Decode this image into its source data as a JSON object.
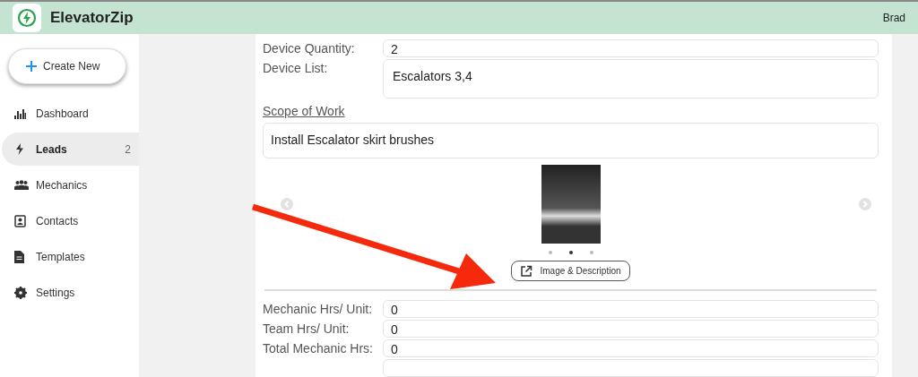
{
  "header": {
    "app_name": "ElevatorZip",
    "user": "Brad"
  },
  "sidebar": {
    "create_button": "Create New",
    "items": [
      {
        "kind": "dashboard",
        "label": "Dashboard",
        "selected": false
      },
      {
        "kind": "leads",
        "label": "Leads",
        "count": "2",
        "selected": true
      },
      {
        "kind": "mechanics",
        "label": "Mechanics",
        "selected": false
      },
      {
        "kind": "contacts",
        "label": "Contacts",
        "selected": false
      },
      {
        "kind": "templates",
        "label": "Templates",
        "selected": false
      },
      {
        "kind": "settings",
        "label": "Settings",
        "selected": false
      }
    ]
  },
  "device_fields": [
    {
      "label": "Device Quantity:",
      "value": "2",
      "kind": "single"
    },
    {
      "label": "Device List:",
      "value": "Escalators 3,4",
      "kind": "multi"
    }
  ],
  "scope": {
    "heading": "Scope of Work",
    "value": "Install Escalator skirt brushes"
  },
  "carousel": {
    "slides": [
      {
        "selected": false
      },
      {
        "selected": true
      },
      {
        "selected": false
      }
    ],
    "button": "Image & Description"
  },
  "hours_fields": [
    {
      "label": "Mechanic Hrs/ Unit:",
      "value": "0"
    },
    {
      "label": "Team Hrs/ Unit:",
      "value": "0"
    },
    {
      "label": "Total Mechanic Hrs:",
      "value": "0"
    }
  ]
}
